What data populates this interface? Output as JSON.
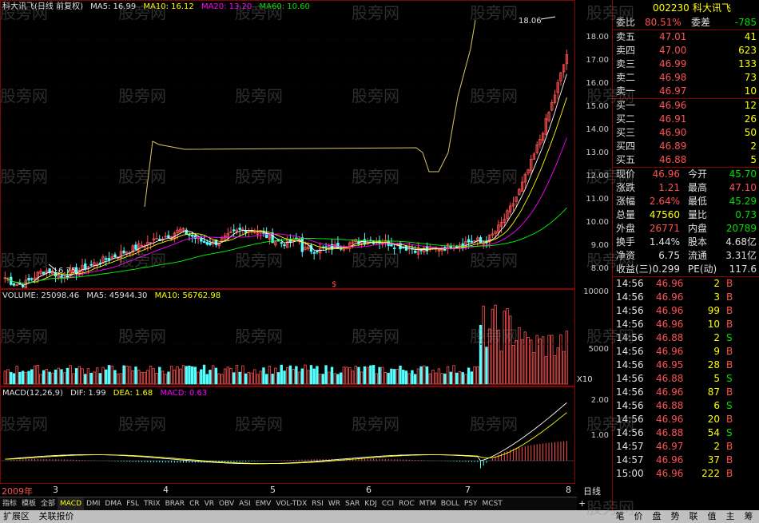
{
  "chart_title": "科大讯飞(日线 前复权)",
  "ma_legend": {
    "ma5": "MA5: 16.99",
    "ma10": "MA10: 16.12",
    "ma20": "MA20: 13.20",
    "ma60": "MA60: 10.60"
  },
  "price_axis": [
    "18.00",
    "17.00",
    "16.00",
    "15.00",
    "14.00",
    "13.00",
    "12.00",
    "11.00",
    "10.00",
    "9.00",
    "8.00"
  ],
  "high_label": "18.06",
  "low_label": "6.75",
  "cursor_mark": "$",
  "volume_legend": {
    "vol": "VOLUME: 25098.46",
    "ma5": "MA5: 45944.30",
    "ma10": "MA10: 56762.98"
  },
  "volume_axis": [
    "10000",
    "5000"
  ],
  "volume_unit": "X10",
  "macd_legend": {
    "params": "MACD(12,26,9)",
    "dif": "DIF: 1.99",
    "dea": "DEA: 1.68",
    "macd": "MACD: 0.63"
  },
  "macd_axis": [
    "2.00",
    "1.00"
  ],
  "x_axis": {
    "year": "2009年",
    "months": [
      "3",
      "4",
      "5",
      "6",
      "7",
      "8"
    ],
    "period": "日线"
  },
  "indicator_tabs": [
    "指标",
    "模板",
    "全部",
    "MACD",
    "DMI",
    "DMA",
    "FSL",
    "TRIX",
    "BRAR",
    "CR",
    "VR",
    "OBV",
    "ASI",
    "EMV",
    "VOL-TDX",
    "RSI",
    "WR",
    "SAR",
    "KDJ",
    "CCI",
    "ROC",
    "MTM",
    "BOLL",
    "PSY",
    "MCST"
  ],
  "active_tab": "MACD",
  "bottom_bar": [
    "扩展区",
    "关联报价"
  ],
  "right_tabs": [
    "笔",
    "价",
    "盘",
    "势",
    "联",
    "值",
    "主",
    "筹"
  ],
  "quote": {
    "code": "002230",
    "name": "科大讯飞",
    "ratio_label": "委比",
    "ratio_value": "80.51%",
    "diff_label": "委差",
    "diff_value": "-785",
    "sell": [
      {
        "label": "卖五",
        "price": "47.01",
        "vol": "41"
      },
      {
        "label": "卖四",
        "price": "47.00",
        "vol": "623"
      },
      {
        "label": "卖三",
        "price": "46.99",
        "vol": "133"
      },
      {
        "label": "卖二",
        "price": "46.98",
        "vol": "73"
      },
      {
        "label": "卖一",
        "price": "46.97",
        "vol": "10"
      }
    ],
    "buy": [
      {
        "label": "买一",
        "price": "46.96",
        "vol": "12"
      },
      {
        "label": "买二",
        "price": "46.91",
        "vol": "26"
      },
      {
        "label": "买三",
        "price": "46.90",
        "vol": "50"
      },
      {
        "label": "买四",
        "price": "46.89",
        "vol": "2"
      },
      {
        "label": "买五",
        "price": "46.88",
        "vol": "5"
      }
    ],
    "stats": [
      {
        "l1": "现价",
        "v1": "46.96",
        "c1": "red",
        "l2": "今开",
        "v2": "45.70",
        "c2": "green"
      },
      {
        "l1": "涨跌",
        "v1": "1.21",
        "c1": "red",
        "l2": "最高",
        "v2": "47.10",
        "c2": "red"
      },
      {
        "l1": "涨幅",
        "v1": "2.64%",
        "c1": "red",
        "l2": "最低",
        "v2": "45.29",
        "c2": "green"
      },
      {
        "l1": "总量",
        "v1": "47560",
        "c1": "yellow",
        "l2": "量比",
        "v2": "0.73",
        "c2": "green"
      },
      {
        "l1": "外盘",
        "v1": "26771",
        "c1": "red",
        "l2": "内盘",
        "v2": "20789",
        "c2": "green"
      },
      {
        "l1": "换手",
        "v1": "1.44%",
        "c1": "white",
        "l2": "股本",
        "v2": "4.68亿",
        "c2": "white"
      },
      {
        "l1": "净资",
        "v1": "6.75",
        "c1": "white",
        "l2": "流通",
        "v2": "3.31亿",
        "c2": "white"
      },
      {
        "l1": "收益(三)",
        "v1": "0.299",
        "c1": "white",
        "l2": "PE(动)",
        "v2": "117.6",
        "c2": "white"
      }
    ],
    "ticks": [
      {
        "t": "14:56",
        "p": "46.96",
        "v": "2",
        "s": "B"
      },
      {
        "t": "14:56",
        "p": "46.96",
        "v": "3",
        "s": "B"
      },
      {
        "t": "14:56",
        "p": "46.96",
        "v": "99",
        "s": "B"
      },
      {
        "t": "14:56",
        "p": "46.96",
        "v": "10",
        "s": "B"
      },
      {
        "t": "14:56",
        "p": "46.88",
        "v": "2",
        "s": "S"
      },
      {
        "t": "14:56",
        "p": "46.96",
        "v": "9",
        "s": "B"
      },
      {
        "t": "14:56",
        "p": "46.95",
        "v": "28",
        "s": "B"
      },
      {
        "t": "14:56",
        "p": "46.88",
        "v": "5",
        "s": "S"
      },
      {
        "t": "14:56",
        "p": "46.96",
        "v": "87",
        "s": "B"
      },
      {
        "t": "14:56",
        "p": "46.88",
        "v": "6",
        "s": "S"
      },
      {
        "t": "14:56",
        "p": "46.96",
        "v": "20",
        "s": "B"
      },
      {
        "t": "14:56",
        "p": "46.88",
        "v": "54",
        "s": "S"
      },
      {
        "t": "14:57",
        "p": "46.97",
        "v": "2",
        "s": "B"
      },
      {
        "t": "14:57",
        "p": "46.96",
        "v": "37",
        "s": "B"
      },
      {
        "t": "15:00",
        "p": "46.96",
        "v": "222",
        "s": "B"
      }
    ]
  },
  "watermark": "股旁网",
  "colors": {
    "up": "#ff5050",
    "down": "#54ffff",
    "ma5": "#ffffff",
    "ma10": "#ffff00",
    "ma20": "#ff00ff",
    "ma60": "#00ff00",
    "frame": "#8b0000"
  }
}
